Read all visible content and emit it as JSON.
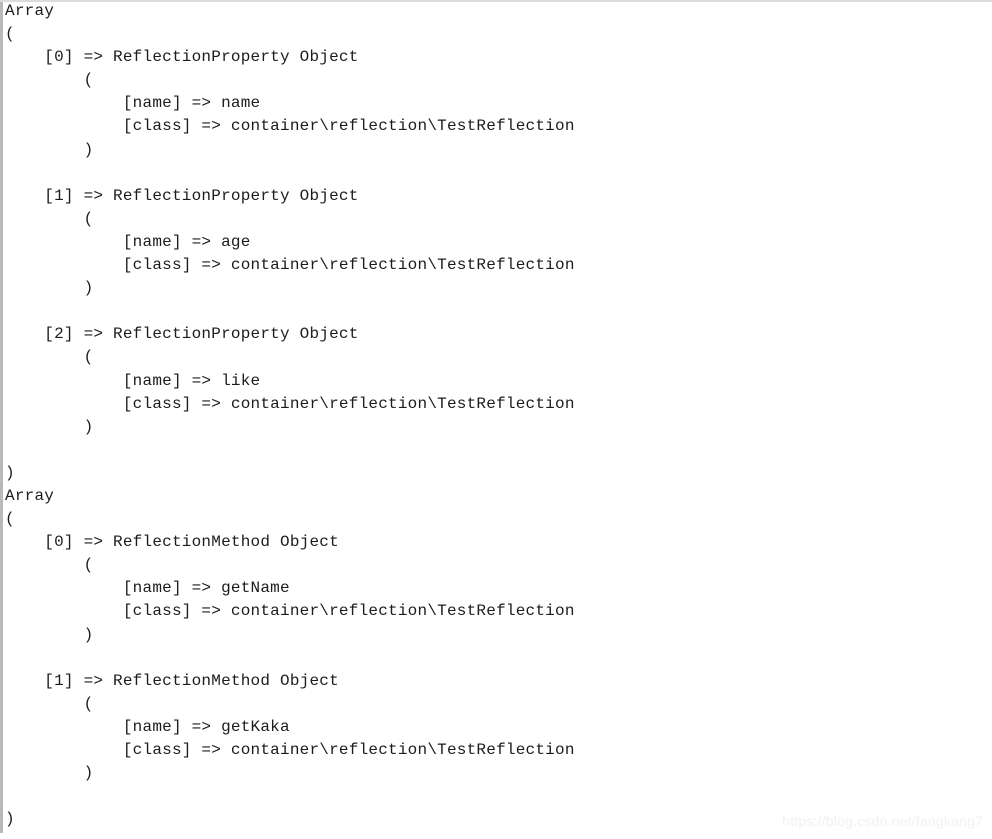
{
  "page": {
    "kind": "php-print-r-output",
    "background_color": "#ffffff",
    "text_color": "#1c1c1c",
    "top_rule_color": "#dcdcdc",
    "left_rule_color": "#b9b9b9"
  },
  "watermark": {
    "text": "https://blog.csdn.net/fangkang7",
    "color": "#f1f1f1"
  },
  "dumps": [
    {
      "header": "Array",
      "class_name": "ReflectionProperty",
      "entries": [
        {
          "index": "[0]",
          "name": "name",
          "class": "container\\reflection\\TestReflection"
        },
        {
          "index": "[1]",
          "name": "age",
          "class": "container\\reflection\\TestReflection"
        },
        {
          "index": "[2]",
          "name": "like",
          "class": "container\\reflection\\TestReflection"
        }
      ]
    },
    {
      "header": "Array",
      "class_name": "ReflectionMethod",
      "entries": [
        {
          "index": "[0]",
          "name": "getName",
          "class": "container\\reflection\\TestReflection"
        },
        {
          "index": "[1]",
          "name": "getKaka",
          "class": "container\\reflection\\TestReflection"
        }
      ]
    }
  ],
  "literals": {
    "open_paren": "(",
    "close_paren": ")",
    "arrow": "=>",
    "object_keyword": "Object",
    "key_name": "[name]",
    "key_class": "[class]"
  },
  "text": {
    "full_dump": "Array\n(\n    [0] => ReflectionProperty Object\n        (\n            [name] => name\n            [class] => container\\reflection\\TestReflection\n        )\n\n    [1] => ReflectionProperty Object\n        (\n            [name] => age\n            [class] => container\\reflection\\TestReflection\n        )\n\n    [2] => ReflectionProperty Object\n        (\n            [name] => like\n            [class] => container\\reflection\\TestReflection\n        )\n\n)\nArray\n(\n    [0] => ReflectionMethod Object\n        (\n            [name] => getName\n            [class] => container\\reflection\\TestReflection\n        )\n\n    [1] => ReflectionMethod Object\n        (\n            [name] => getKaka\n            [class] => container\\reflection\\TestReflection\n        )\n\n)"
  }
}
